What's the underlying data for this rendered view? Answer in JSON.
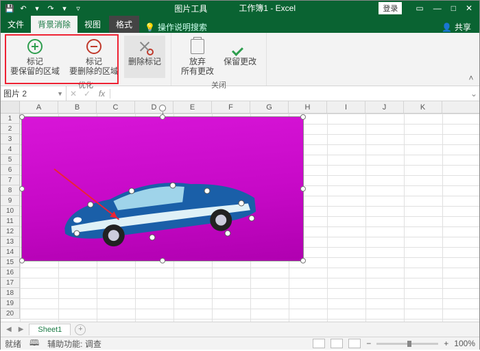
{
  "title": {
    "pictools": "图片工具",
    "doc": "工作簿1 - Excel",
    "login": "登录"
  },
  "tabs": {
    "file": "文件",
    "bgremove": "背景消除",
    "view": "视图",
    "format": "格式",
    "tellme": "操作说明搜索",
    "share": "共享"
  },
  "ribbon": {
    "mark_keep": {
      "l1": "标记",
      "l2": "要保留的区域"
    },
    "mark_remove": {
      "l1": "标记",
      "l2": "要删除的区域"
    },
    "delete_mark": {
      "l1": "删除标记"
    },
    "discard": {
      "l1": "放弃",
      "l2": "所有更改"
    },
    "keep": {
      "l1": "保留更改"
    },
    "group_refine": "优化",
    "group_close": "关闭"
  },
  "namebox": "图片 2",
  "cols": [
    "A",
    "B",
    "C",
    "D",
    "E",
    "F",
    "G",
    "H",
    "I",
    "J",
    "K"
  ],
  "rows": [
    "1",
    "2",
    "3",
    "4",
    "5",
    "6",
    "7",
    "8",
    "9",
    "10",
    "11",
    "12",
    "13",
    "14",
    "15",
    "16",
    "17",
    "18",
    "19",
    "20"
  ],
  "sheet": {
    "name": "Sheet1"
  },
  "status": {
    "ready": "就绪",
    "assist": "辅助功能: 调查",
    "zoom": "100%"
  }
}
